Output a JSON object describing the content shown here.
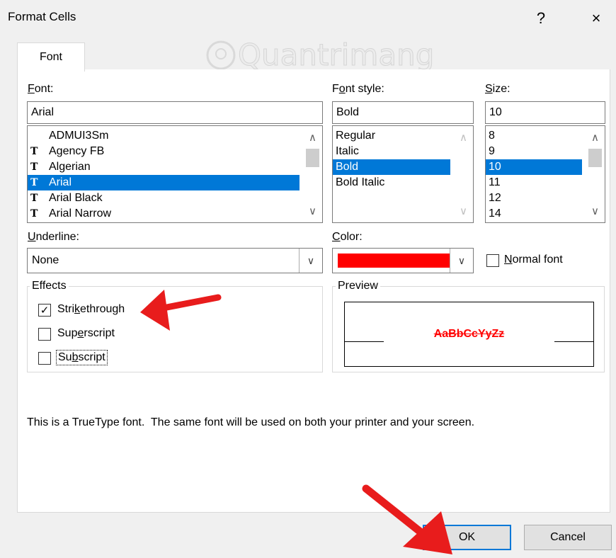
{
  "window": {
    "title": "Format Cells",
    "help": "?",
    "close": "×"
  },
  "watermark": "Quantrimang",
  "tabs": [
    {
      "label": "Font",
      "active": true
    }
  ],
  "font": {
    "label_prefix": "",
    "label_u": "F",
    "label_rest": "ont:",
    "value": "Arial",
    "items": [
      {
        "label": "ADMUI3Sm",
        "truetype": false,
        "selected": false
      },
      {
        "label": "Agency FB",
        "truetype": true,
        "selected": false
      },
      {
        "label": "Algerian",
        "truetype": true,
        "selected": false
      },
      {
        "label": "Arial",
        "truetype": true,
        "selected": true
      },
      {
        "label": "Arial Black",
        "truetype": true,
        "selected": false
      },
      {
        "label": "Arial Narrow",
        "truetype": true,
        "selected": false
      }
    ],
    "truetype_glyph": "T"
  },
  "font_style": {
    "label_prefix": "F",
    "label_u": "o",
    "label_rest": "nt style:",
    "value": "Bold",
    "items": [
      {
        "label": "Regular",
        "selected": false
      },
      {
        "label": "Italic",
        "selected": false
      },
      {
        "label": "Bold",
        "selected": true
      },
      {
        "label": "Bold Italic",
        "selected": false
      }
    ]
  },
  "size": {
    "label_prefix": "",
    "label_u": "S",
    "label_rest": "ize:",
    "value": "10",
    "items": [
      {
        "label": "8",
        "selected": false
      },
      {
        "label": "9",
        "selected": false
      },
      {
        "label": "10",
        "selected": true
      },
      {
        "label": "11",
        "selected": false
      },
      {
        "label": "12",
        "selected": false
      },
      {
        "label": "14",
        "selected": false
      }
    ]
  },
  "underline": {
    "label_prefix": "",
    "label_u": "U",
    "label_rest": "nderline:",
    "value": "None"
  },
  "color": {
    "label_prefix": "",
    "label_u": "C",
    "label_rest": "olor:",
    "swatch": "#ff0000"
  },
  "normal_font": {
    "label_prefix": "",
    "label_u": "N",
    "label_rest": "ormal font",
    "checked": false
  },
  "effects": {
    "label": "Effects",
    "strikethrough": {
      "label_prefix": "Stri",
      "label_u": "k",
      "label_rest": "ethrough",
      "checked": true
    },
    "superscript": {
      "label_prefix": "Sup",
      "label_u": "e",
      "label_rest": "rscript",
      "checked": false
    },
    "subscript": {
      "label_prefix": "Su",
      "label_u": "b",
      "label_rest": "script",
      "checked": false
    }
  },
  "preview": {
    "label": "Preview",
    "sample": "AaBbCcYyZz",
    "color": "#ff0000"
  },
  "info_text": "This is a TrueType font.  The same font will be used on both your printer and your screen.",
  "buttons": {
    "ok": "OK",
    "cancel": "Cancel"
  },
  "annotation_color": "#e81c1c",
  "icons": {
    "scroll_up": "^",
    "scroll_down": "v",
    "dropdown": "chevron-down",
    "check": "✓"
  }
}
